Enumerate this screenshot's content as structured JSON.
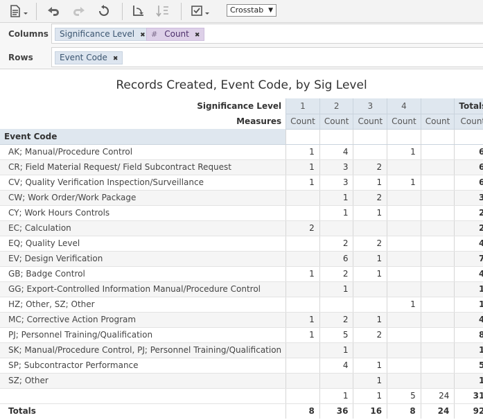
{
  "toolbar": {
    "view_selector": "Crosstab",
    "icons": [
      "export-icon",
      "undo-icon",
      "redo-icon",
      "reset-icon",
      "swap-axes-icon",
      "sort-icon",
      "options-icon"
    ]
  },
  "config": {
    "columns_label": "Columns",
    "rows_label": "Rows",
    "column_fields": [
      "Significance Level"
    ],
    "measure_fields": [
      "Count"
    ],
    "measure_prefix": "#",
    "row_fields": [
      "Event Code"
    ],
    "remove_glyph": "✖"
  },
  "report": {
    "title": "Records Created, Event Code, by Sig Level",
    "col_dim_label": "Significance Level",
    "measures_label": "Measures",
    "row_dim_label": "Event Code",
    "col_groups": [
      "1",
      "2",
      "3",
      "4",
      "",
      "Totals"
    ],
    "measure_names": [
      "Count",
      "Count",
      "Count",
      "Count",
      "Count",
      "Count"
    ],
    "rows": [
      {
        "label": "AK; Manual/Procedure Control",
        "cells": [
          "1",
          "4",
          "",
          "1",
          ""
        ],
        "total": "6"
      },
      {
        "label": "CR; Field Material Request/ Field Subcontract Request",
        "cells": [
          "1",
          "3",
          "2",
          "",
          ""
        ],
        "total": "6"
      },
      {
        "label": "CV; Quality Verification Inspection/Surveillance",
        "cells": [
          "1",
          "3",
          "1",
          "1",
          ""
        ],
        "total": "6"
      },
      {
        "label": "CW; Work Order/Work Package",
        "cells": [
          "",
          "1",
          "2",
          "",
          ""
        ],
        "total": "3"
      },
      {
        "label": "CY; Work Hours Controls",
        "cells": [
          "",
          "1",
          "1",
          "",
          ""
        ],
        "total": "2"
      },
      {
        "label": "EC; Calculation",
        "cells": [
          "2",
          "",
          "",
          "",
          ""
        ],
        "total": "2"
      },
      {
        "label": "EQ; Quality Level",
        "cells": [
          "",
          "2",
          "2",
          "",
          ""
        ],
        "total": "4"
      },
      {
        "label": "EV; Design Verification",
        "cells": [
          "",
          "6",
          "1",
          "",
          ""
        ],
        "total": "7"
      },
      {
        "label": "GB; Badge Control",
        "cells": [
          "1",
          "2",
          "1",
          "",
          ""
        ],
        "total": "4"
      },
      {
        "label": "GG; Export-Controlled Information Manual/Procedure Control",
        "cells": [
          "",
          "1",
          "",
          "",
          ""
        ],
        "total": "1"
      },
      {
        "label": "HZ; Other, SZ; Other",
        "cells": [
          "",
          "",
          "",
          "1",
          ""
        ],
        "total": "1"
      },
      {
        "label": "MC; Corrective Action Program",
        "cells": [
          "1",
          "2",
          "1",
          "",
          ""
        ],
        "total": "4"
      },
      {
        "label": "PJ; Personnel Training/Qualification",
        "cells": [
          "1",
          "5",
          "2",
          "",
          ""
        ],
        "total": "8"
      },
      {
        "label": "SK; Manual/Procedure Control, PJ; Personnel Training/Qualification",
        "cells": [
          "",
          "1",
          "",
          "",
          ""
        ],
        "total": "1"
      },
      {
        "label": "SP; Subcontractor Performance",
        "cells": [
          "",
          "4",
          "1",
          "",
          ""
        ],
        "total": "5"
      },
      {
        "label": "SZ; Other",
        "cells": [
          "",
          "",
          "1",
          "",
          ""
        ],
        "total": "1"
      },
      {
        "label": "",
        "cells": [
          "",
          "1",
          "1",
          "5",
          "24"
        ],
        "total": "31"
      }
    ],
    "totals": {
      "label": "Totals",
      "cells": [
        "8",
        "36",
        "16",
        "8",
        "24"
      ],
      "total": "92"
    }
  }
}
